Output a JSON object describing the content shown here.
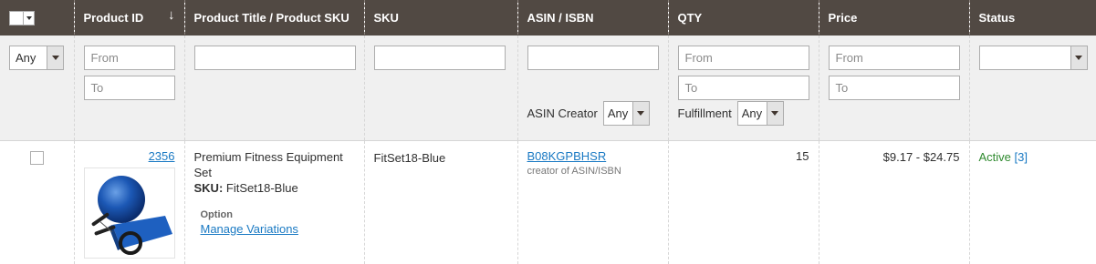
{
  "headers": {
    "product_id": "Product ID",
    "title": "Product Title / Product SKU",
    "sku": "SKU",
    "asin": "ASIN / ISBN",
    "qty": "QTY",
    "price": "Price",
    "status": "Status",
    "sort_indicator": "↓"
  },
  "filters": {
    "select_value": "Any",
    "id_from_placeholder": "From",
    "id_to_placeholder": "To",
    "asin_creator_label": "ASIN Creator",
    "asin_creator_value": "Any",
    "qty_from_placeholder": "From",
    "qty_to_placeholder": "To",
    "fulfillment_label": "Fulfillment",
    "fulfillment_value": "Any",
    "price_from_placeholder": "From",
    "price_to_placeholder": "To",
    "status_value": ""
  },
  "row": {
    "product_id": "2356",
    "title": "Premium Fitness Equipment Set",
    "sku_label": "SKU:",
    "sku_value": "FitSet18-Blue",
    "option_label": "Option",
    "manage_variations": "Manage Variations",
    "sku": "FitSet18-Blue",
    "asin": "B08KGPBHSR",
    "asin_note": "creator of ASIN/ISBN",
    "qty": "15",
    "price": "$9.17 - $24.75",
    "status": "Active",
    "status_count": "[3]"
  },
  "colors": {
    "header_bg": "#514943",
    "filter_bg": "#f0f0f0",
    "link": "#1979c3",
    "active": "#2f8a2f"
  }
}
